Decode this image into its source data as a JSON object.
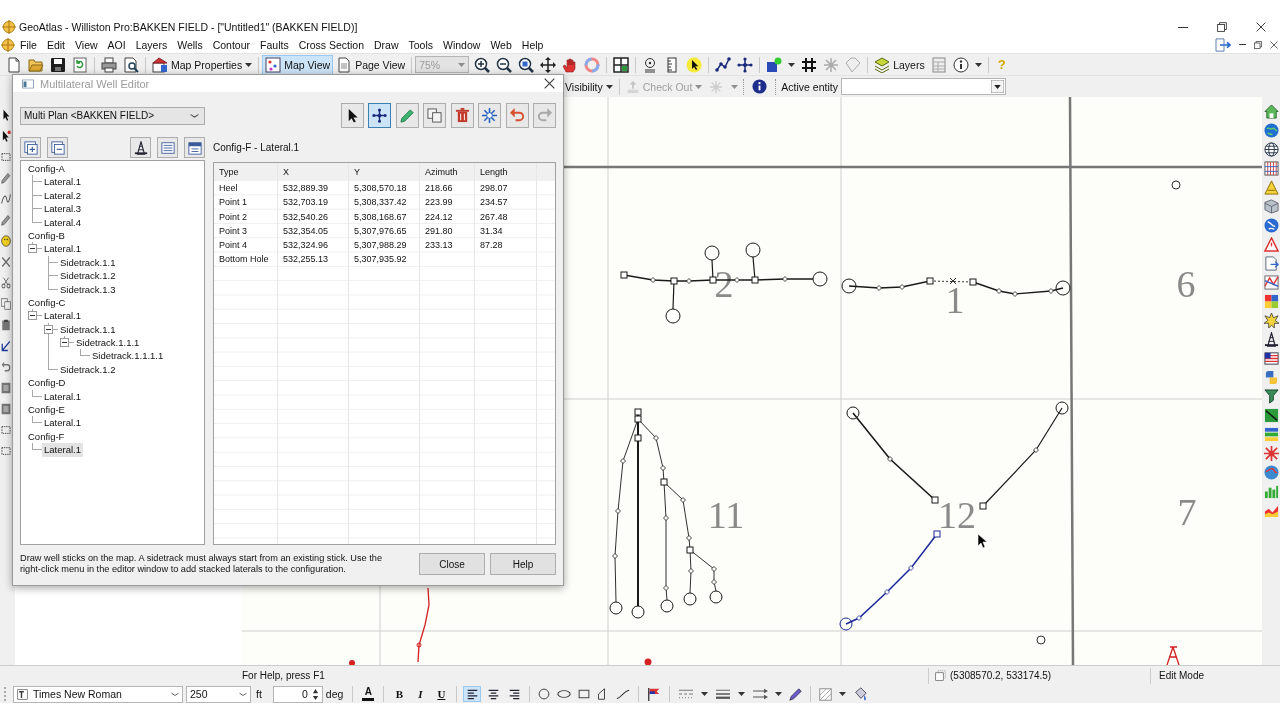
{
  "window": {
    "title": "GeoAtlas - Williston Pro:BAKKEN FIELD - [\"Untitled1\" (BAKKEN FIELD)]"
  },
  "menu": [
    "File",
    "Edit",
    "View",
    "AOI",
    "Layers",
    "Wells",
    "Contour",
    "Faults",
    "Cross Section",
    "Draw",
    "Tools",
    "Window",
    "Web",
    "Help"
  ],
  "toolbar": {
    "map_properties": "Map Properties",
    "views": [
      {
        "label": "Map View",
        "selected": true
      },
      {
        "label": "Page View",
        "selected": false
      }
    ],
    "zoom": {
      "value": "75%",
      "disabled": true
    },
    "layers": "Layers",
    "help": "?"
  },
  "toolbar2": {
    "visibility": "Visibility",
    "check_out": {
      "label": "Check Out",
      "disabled": true
    },
    "active_entity": "Active entity"
  },
  "dialog": {
    "title": "Multilateral Well Editor",
    "plan": "Multi Plan <BAKKEN FIELD>",
    "tools": [
      {
        "selected": false,
        "disabled": false
      },
      {
        "selected": true,
        "disabled": false
      },
      {
        "selected": false,
        "disabled": false
      },
      {
        "selected": false,
        "disabled": false
      },
      {
        "selected": false,
        "disabled": false
      },
      {
        "selected": false,
        "disabled": false
      },
      {
        "selected": false,
        "disabled": false
      },
      {
        "selected": false,
        "disabled": true
      }
    ],
    "tree": [
      {
        "label": "Config-A",
        "selected": false,
        "children": [
          {
            "label": "Lateral.1",
            "selected": false
          },
          {
            "label": "Lateral.2",
            "selected": false
          },
          {
            "label": "Lateral.3",
            "selected": false
          },
          {
            "label": "Lateral.4",
            "selected": false
          }
        ]
      },
      {
        "label": "Config-B",
        "selected": false,
        "children": [
          {
            "label": "Lateral.1",
            "selected": false,
            "expanded": true,
            "children": [
              {
                "label": "Sidetrack.1.1",
                "selected": false
              },
              {
                "label": "Sidetrack.1.2",
                "selected": false
              },
              {
                "label": "Sidetrack.1.3",
                "selected": false
              }
            ]
          }
        ]
      },
      {
        "label": "Config-C",
        "selected": false,
        "children": [
          {
            "label": "Lateral.1",
            "selected": false,
            "expanded": true,
            "children": [
              {
                "label": "Sidetrack.1.1",
                "selected": false,
                "expanded": true,
                "children": [
                  {
                    "label": "Sidetrack.1.1.1",
                    "selected": false,
                    "expanded": true,
                    "children": [
                      {
                        "label": "Sidetrack.1.1.1.1",
                        "selected": false
                      }
                    ]
                  }
                ]
              },
              {
                "label": "Sidetrack.1.2",
                "selected": false
              }
            ]
          }
        ]
      },
      {
        "label": "Config-D",
        "selected": false,
        "children": [
          {
            "label": "Lateral.1",
            "selected": false
          }
        ]
      },
      {
        "label": "Config-E",
        "selected": false,
        "children": [
          {
            "label": "Lateral.1",
            "selected": false
          }
        ]
      },
      {
        "label": "Config-F",
        "selected": false,
        "children": [
          {
            "label": "Lateral.1",
            "selected": true
          }
        ]
      }
    ],
    "caption": "Config-F - Lateral.1",
    "table": {
      "columns": [
        "Type",
        "X",
        "Y",
        "Azimuth",
        "Length"
      ],
      "rows": [
        [
          "Heel",
          "532,889.39",
          "5,308,570.18",
          "218.66",
          "298.07"
        ],
        [
          "Point 1",
          "532,703.19",
          "5,308,337.42",
          "223.99",
          "234.57"
        ],
        [
          "Point 2",
          "532,540.26",
          "5,308,168.67",
          "224.12",
          "267.48"
        ],
        [
          "Point 3",
          "532,354.05",
          "5,307,976.65",
          "291.80",
          "31.34"
        ],
        [
          "Point 4",
          "532,324.96",
          "5,307,988.29",
          "233.13",
          "87.28"
        ],
        [
          "Bottom Hole",
          "532,255.13",
          "5,307,935.92"
        ]
      ]
    },
    "hint": "Draw well sticks on the map. A sidetrack must always start from an existing stick. Use the right-click menu in the editor window to add stacked laterals to the configuration.",
    "buttons": [
      "Close",
      "Help"
    ]
  },
  "map": {
    "sections": [
      "2",
      "1",
      "6",
      "11",
      "12",
      "7"
    ]
  },
  "status_bar": {
    "help": "For Help, press F1",
    "coordinates": "(5308570.2, 533174.5)",
    "mode": "Edit Mode"
  },
  "format_bar": {
    "font": "Times New Roman",
    "size": "250",
    "size_unit": "ft",
    "angle": "0",
    "angle_unit": "deg",
    "font_color": "A",
    "styles": [
      {
        "kind": "bold",
        "label": "B"
      },
      {
        "kind": "italic",
        "label": "I"
      },
      {
        "kind": "underline",
        "label": "U"
      }
    ],
    "alignment": [
      {
        "selected": true
      },
      {
        "selected": false
      },
      {
        "selected": false
      }
    ]
  }
}
